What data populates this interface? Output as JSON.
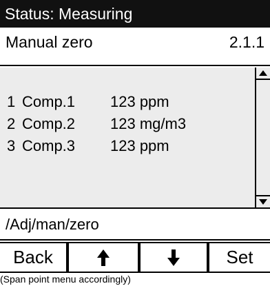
{
  "status": {
    "text": "Status: Measuring"
  },
  "menu": {
    "title": "Manual zero",
    "code": "2.1.1"
  },
  "components": [
    {
      "index": "1",
      "name": "Comp.1",
      "value": "123 ppm"
    },
    {
      "index": "2",
      "name": "Comp.2",
      "value": "123 mg/m3"
    },
    {
      "index": "3",
      "name": "Comp.3",
      "value": "123 ppm"
    }
  ],
  "path": "/Adj/man/zero",
  "softkeys": {
    "back": "Back",
    "up_icon": "arrow-up-icon",
    "down_icon": "arrow-down-icon",
    "set": "Set"
  },
  "caption": "(Span point menu accordingly)",
  "colors": {
    "status_bg": "#111111",
    "list_bg": "#ececec"
  }
}
